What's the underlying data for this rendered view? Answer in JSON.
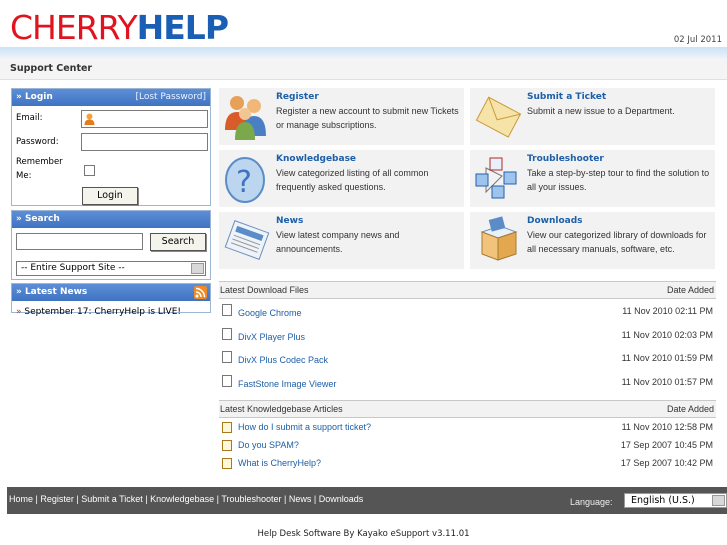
{
  "header": {
    "logo_part1": "CHERRY",
    "logo_part2": "HELP",
    "date": "02 Jul 2011"
  },
  "page_title": "Support Center",
  "login": {
    "title": "» Login",
    "lost_password": "[Lost Password]",
    "email_label": "Email:",
    "password_label": "Password:",
    "remember_label_1": "Remember",
    "remember_label_2": "Me:",
    "login_button": "Login"
  },
  "search": {
    "title": "» Search",
    "button": "Search",
    "scope_selected": "-- Entire Support Site --"
  },
  "news": {
    "title": "» Latest News",
    "item_bullet": "»",
    "item": "September 17: CherryHelp is LIVE!"
  },
  "tiles": [
    {
      "title": "Register",
      "desc": "Register a new account to submit new Tickets or manage subscriptions.",
      "icon": "users-icon"
    },
    {
      "title": "Submit a Ticket",
      "desc": "Submit a new issue to a Department.",
      "icon": "envelope-icon"
    },
    {
      "title": "Knowledgebase",
      "desc": "View categorized listing of all common frequently asked questions.",
      "icon": "question-icon"
    },
    {
      "title": "Troubleshooter",
      "desc": "Take a step-by-step tour to find the solution to all your issues.",
      "icon": "cubes-icon"
    },
    {
      "title": "News",
      "desc": "View latest company news and announcements.",
      "icon": "newspaper-icon"
    },
    {
      "title": "Downloads",
      "desc": "View our categorized library of downloads for all necessary manuals, software, etc.",
      "icon": "box-icon"
    }
  ],
  "downloads": {
    "header": "Latest Download Files",
    "date_header": "Date Added",
    "rows": [
      {
        "name": "Google Chrome",
        "date": "11 Nov 2010 02:11 PM"
      },
      {
        "name": "DivX Player Plus",
        "date": "11 Nov 2010 02:03 PM"
      },
      {
        "name": "DivX Plus Codec Pack",
        "date": "11 Nov 2010 01:59 PM"
      },
      {
        "name": "FastStone Image Viewer",
        "date": "11 Nov 2010 01:57 PM"
      }
    ]
  },
  "kb": {
    "header": "Latest Knowledgebase Articles",
    "date_header": "Date Added",
    "rows": [
      {
        "name": "How do I submit a support ticket?",
        "date": "11 Nov 2010 12:58 PM"
      },
      {
        "name": "Do you SPAM?",
        "date": "17 Sep 2007 10:45 PM"
      },
      {
        "name": "What is CherryHelp?",
        "date": "17 Sep 2007 10:42 PM"
      }
    ]
  },
  "footer": {
    "links": [
      "Home",
      "Register",
      "Submit a Ticket",
      "Knowledgebase",
      "Troubleshooter",
      "News",
      "Downloads"
    ],
    "separator": " | ",
    "language_label": "Language:",
    "language_selected": "English (U.S.)"
  },
  "powered_by": "Help Desk Software By Kayako eSupport v3.11.01",
  "colors": {
    "brand_red": "#e0141e",
    "brand_blue": "#1a5fb4",
    "link": "#1d5fa8",
    "box_head": "#4a7ec9"
  }
}
